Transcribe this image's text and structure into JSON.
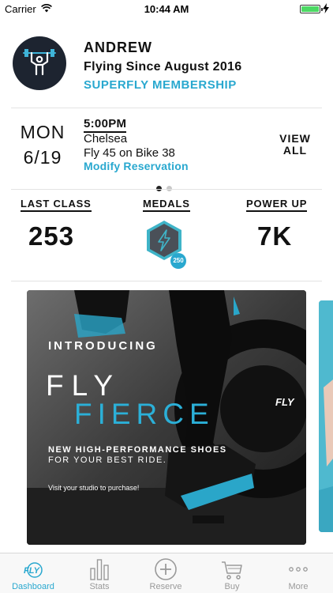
{
  "status_bar": {
    "carrier": "Carrier",
    "time": "10:44 AM"
  },
  "profile": {
    "name": "ANDREW",
    "since": "Flying Since August 2016",
    "membership": "SUPERFLY MEMBERSHIP"
  },
  "reservation": {
    "day": "MON",
    "date": "6/19",
    "time": "5:00PM",
    "location": "Chelsea",
    "details": "Fly 45 on Bike 38",
    "modify_label": "Modify Reservation",
    "view_all_line1": "VIEW",
    "view_all_line2": "ALL",
    "pager": {
      "count": 2,
      "active": 1
    }
  },
  "stats": {
    "last_class_label": "LAST CLASS",
    "last_class_value": "253",
    "medals_label": "MEDALS",
    "medal_badge": "250",
    "power_up_label": "POWER UP",
    "power_up_value": "7K"
  },
  "promo": {
    "introducing": "INTRODUCING",
    "title_line1": "FLY",
    "title_line2": "FIERCE",
    "logo": "FLY",
    "subtitle_line1": "NEW HIGH-PERFORMANCE SHOES",
    "subtitle_line2": "FOR YOUR BEST RIDE.",
    "cta": "Visit your studio to purchase!"
  },
  "tabs": [
    {
      "label": "Dashboard",
      "icon": "fly-logo-icon",
      "active": true
    },
    {
      "label": "Stats",
      "icon": "bar-chart-icon",
      "active": false
    },
    {
      "label": "Reserve",
      "icon": "plus-circle-icon",
      "active": false
    },
    {
      "label": "Buy",
      "icon": "cart-icon",
      "active": false
    },
    {
      "label": "More",
      "icon": "ellipsis-icon",
      "active": false
    }
  ],
  "colors": {
    "accent": "#29a8cf",
    "avatar_bg": "#1d2430",
    "battery": "#4cd964",
    "medal_rim": "#3fb4c8",
    "medal_body": "#4a5058"
  }
}
